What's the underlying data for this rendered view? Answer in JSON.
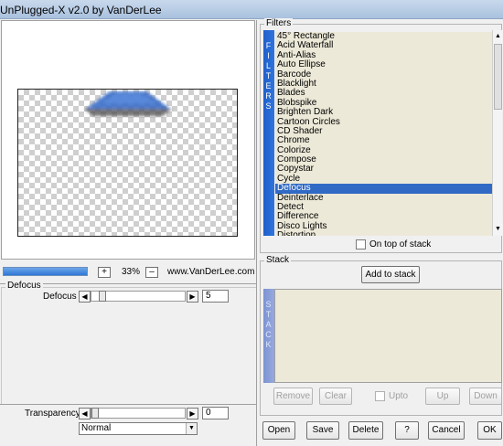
{
  "window": {
    "title": "UnPlugged-X v2.0 by VanDerLee"
  },
  "preview": {
    "zoom_in": "+",
    "zoom_value": "33%",
    "zoom_out": "–",
    "website": "www.VanDerLee.com",
    "colors": {
      "shape": "#3a6fc9",
      "shadow": "#4a4a4a"
    }
  },
  "params": {
    "group_label": "Defocus",
    "defocus_label": "Defocus",
    "defocus_value": "5",
    "transparency_label": "Transparency",
    "transparency_value": "0",
    "blend_mode": "Normal"
  },
  "filters": {
    "group_label": "Filters",
    "strip_label": "FILTERS",
    "items": [
      "45° Rectangle",
      "Acid Waterfall",
      "Anti-Alias",
      "Auto Ellipse",
      "Barcode",
      "Blacklight",
      "Blades",
      "Blobspike",
      "Brighten Dark",
      "Cartoon Circles",
      "CD Shader",
      "Chrome",
      "Colorize",
      "Compose",
      "Copystar",
      "Cycle",
      "Defocus",
      "Deinterlace",
      "Detect",
      "Difference",
      "Disco Lights",
      "Distortion"
    ],
    "selected": "Defocus",
    "on_top_label": "On top of stack"
  },
  "stack": {
    "group_label": "Stack",
    "add_button": "Add to stack",
    "strip_label": "STACK",
    "buttons": {
      "remove": "Remove",
      "clear": "Clear",
      "upto": "Upto",
      "up": "Up",
      "down": "Down"
    }
  },
  "footer": {
    "open": "Open",
    "save": "Save",
    "delete": "Delete",
    "help": "?",
    "cancel": "Cancel",
    "ok": "OK"
  },
  "colors": {
    "accent": "#316ac5",
    "list_bg": "#ece9d8"
  }
}
